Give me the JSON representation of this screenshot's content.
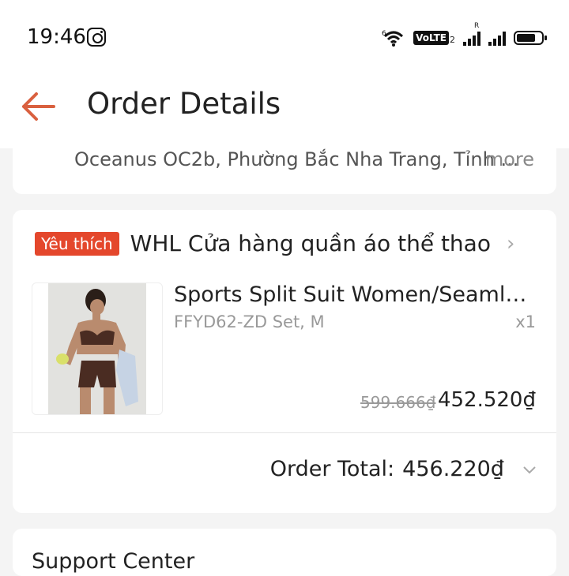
{
  "status_bar": {
    "time": "19:46",
    "wifi_label": "6",
    "volte_label": "VoLTE",
    "volte_sub": "2",
    "roaming_label": "R"
  },
  "header": {
    "title": "Order Details"
  },
  "address": {
    "text": "Oceanus OC2b, Phường Bắc Nha Trang, Tỉnh ...",
    "more_label": "more"
  },
  "shop": {
    "badge": "Yêu thích",
    "name": "WHL Cửa hàng quần áo thể thao"
  },
  "product": {
    "name": "Sports Split Suit Women/Seamles...",
    "variant": "FFYD62-ZD Set, M",
    "quantity": "x1",
    "original_price": "599.666₫",
    "sale_price": "452.520₫"
  },
  "order_total": {
    "label": "Order Total:",
    "value": "456.220₫"
  },
  "support": {
    "title": "Support Center"
  },
  "colors": {
    "accent": "#e4472c",
    "back_arrow": "#d9603f"
  }
}
